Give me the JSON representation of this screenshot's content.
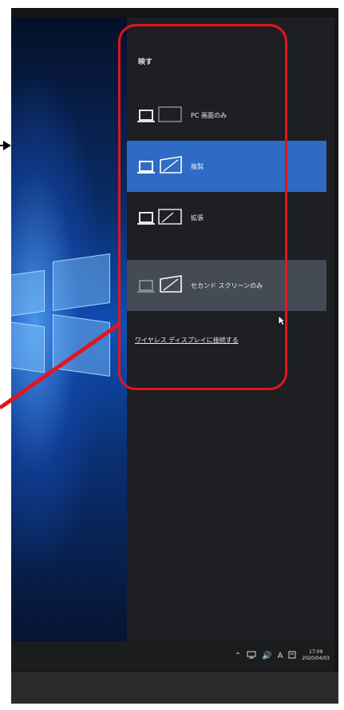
{
  "panel": {
    "title": "映す",
    "options": [
      {
        "label": "PC 画面のみ",
        "icon": "pc-screen-only-icon",
        "state": "normal"
      },
      {
        "label": "複製",
        "icon": "duplicate-icon",
        "state": "selected"
      },
      {
        "label": "拡張",
        "icon": "extend-icon",
        "state": "normal"
      },
      {
        "label": "セカンド スクリーンのみ",
        "icon": "second-screen-only-icon",
        "state": "hovered"
      }
    ],
    "wireless_link": "ワイヤレス ディスプレイに接続する"
  },
  "taskbar": {
    "ime_indicator": "A",
    "clock_time": "17:09",
    "clock_date": "2020/04/03"
  },
  "colors": {
    "selected": "#2f6bc4",
    "hovered": "#444b55",
    "annotation": "#e3151c"
  }
}
